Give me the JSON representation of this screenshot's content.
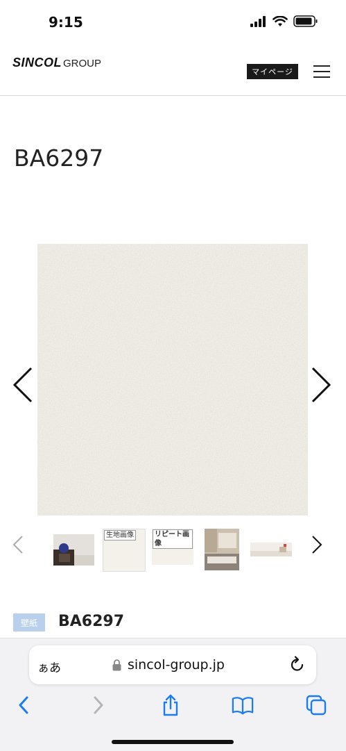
{
  "status_bar": {
    "time": "9:15",
    "icons": [
      "cellular-signal-icon",
      "wifi-icon",
      "battery-icon"
    ]
  },
  "header": {
    "logo_main": "SINCOL",
    "logo_sub": "GROUP",
    "mypage_label": "マイページ",
    "menu_icon": "hamburger-menu-icon"
  },
  "product": {
    "title": "BA6297",
    "thumbnails": [
      {
        "name": "room-photo",
        "label": ""
      },
      {
        "name": "fabric-image",
        "label": "生地画像"
      },
      {
        "name": "repeat-image",
        "label": "リピート画像"
      },
      {
        "name": "bedroom-photo",
        "label": ""
      },
      {
        "name": "living-photo",
        "label": ""
      }
    ],
    "category_badge": "壁紙",
    "category_code": "BA6297"
  },
  "browser": {
    "aa_label": "ぁあ",
    "url": "sincol-group.jp",
    "toolbar": [
      "back-icon",
      "forward-icon",
      "share-icon",
      "bookmarks-icon",
      "tabs-icon"
    ]
  },
  "colors": {
    "accent_blue": "#1a7cf0",
    "badge_blue": "#b9d0ec",
    "texture": "#f3f1ea"
  }
}
